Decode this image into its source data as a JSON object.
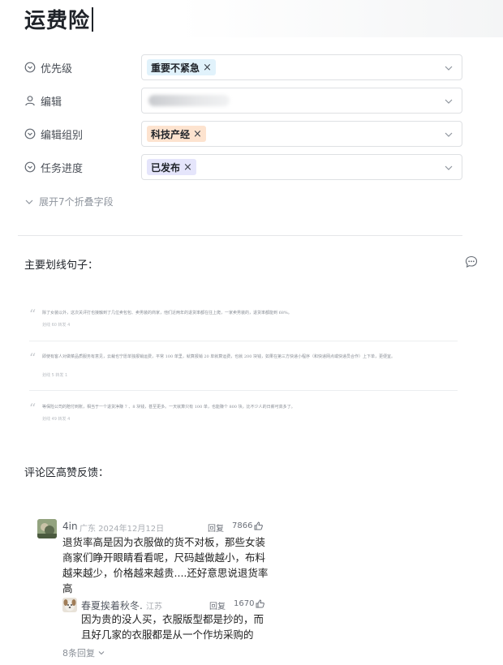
{
  "page": {
    "title": "运费险"
  },
  "fields": [
    {
      "label": "优先级",
      "value": "重要不紧急",
      "icon": "circle-chevron-icon"
    },
    {
      "label": "编辑",
      "value": "",
      "icon": "person-icon"
    },
    {
      "label": "编辑组别",
      "value": "科技产经",
      "icon": "circle-chevron-icon"
    },
    {
      "label": "任务进度",
      "value": "已发布",
      "icon": "circle-chevron-icon"
    }
  ],
  "expand_label": "展开7个折叠字段",
  "highlights": {
    "title": "主要划线句子：",
    "items": [
      {
        "text": "除了女装以外，这次关评打也接触到了几位卖包包、卖男装的商家，他们近两年的退货率都在往上爬，一家卖男装的，退货率都能到 68%。",
        "meta": "划线 60   转发 4"
      },
      {
        "text": "即使有客人对做菜品质服务有意见，云裁也宁愿单独报销运费，平常 100 单里，就算报销 20 单就算运费，也就 200 块钱，如果在第三方快递小程序（和快递网点或快递员合作）上下单，更便宜。",
        "meta": "划线 5   转发 1"
      },
      {
        "text": "等保险公司的赔付到账，相当于一个退货净赚 7 、8 块钱，甚至更多。一天就算只有 100 单，也能赚个 800 块，比不少人的日薪可高多了。",
        "meta": "划线 49   转发 4"
      }
    ]
  },
  "comments_section": {
    "title": "评论区高赞反馈：",
    "comment": {
      "user": "4in",
      "meta": "广东 2024年12月12日",
      "reply_label": "回复",
      "likes": "7866",
      "text_lines": [
        "退货率高是因为衣服做的货不对板，那些女装",
        "商家们睁开眼睛看看呢，尺码越做越小，布料",
        "越来越少，价格越来越贵....还好意思说退货率",
        "高"
      ]
    },
    "reply": {
      "user": "春夏挨着秋冬.",
      "meta": "江苏",
      "reply_label": "回复",
      "likes": "1670",
      "text_lines": [
        "因为贵的没人买，衣服版型都是抄的，而",
        "且好几家的衣服都是从一个作坊采购的"
      ]
    },
    "more_replies": "8条回复"
  }
}
